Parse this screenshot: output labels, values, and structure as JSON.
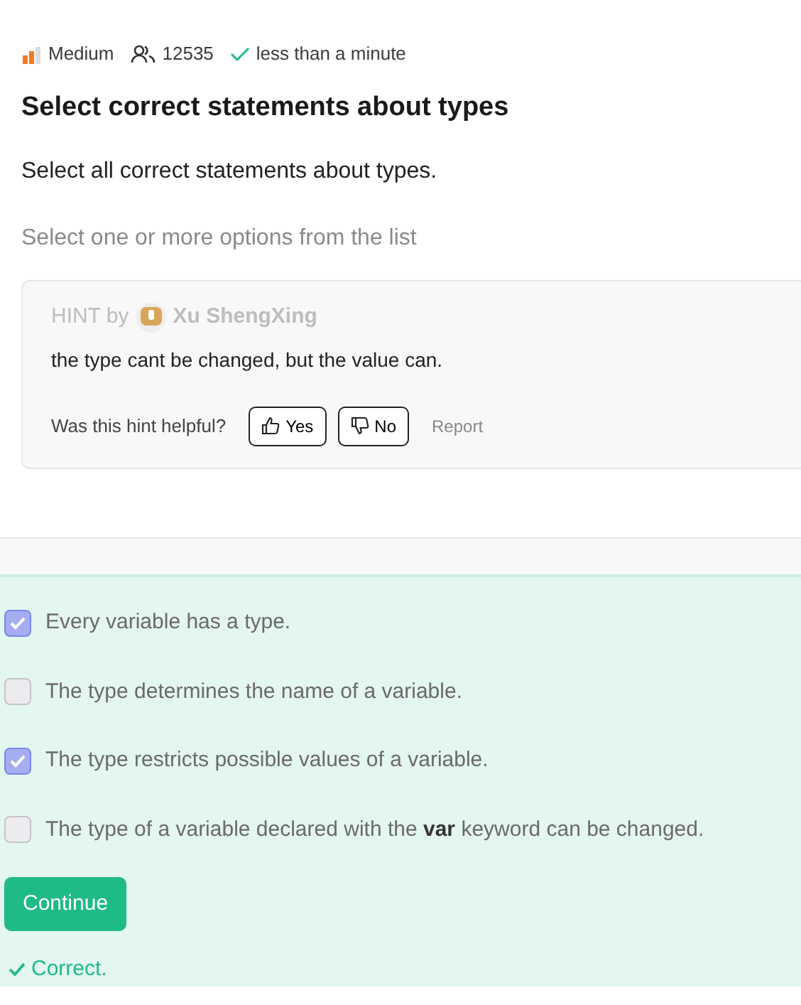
{
  "meta": {
    "difficulty": {
      "label": "Medium",
      "level": 0.67
    },
    "solvers": "12535",
    "time": "less than a minute"
  },
  "title": "Select correct statements about types",
  "question": "Select all correct statements about types.",
  "instruction": "Select one or more options from the list",
  "hint": {
    "prefix": "HINT by",
    "author": "Xu ShengXing",
    "text": "the type cant be changed, but the value can.",
    "helpful_prompt": "Was this hint helpful?",
    "yes": "Yes",
    "no": "No",
    "report": "Report"
  },
  "options": [
    {
      "text": "Every variable has a type.",
      "checked": true
    },
    {
      "text": "The type determines the name of a variable.",
      "checked": false
    },
    {
      "text": "The type restricts possible values of a variable.",
      "checked": true
    },
    {
      "text": "The type of a variable declared with the **var** keyword can be changed.",
      "checked": false
    }
  ],
  "continue_button": "Continue",
  "result": {
    "text": "Correct.",
    "correct": true
  }
}
